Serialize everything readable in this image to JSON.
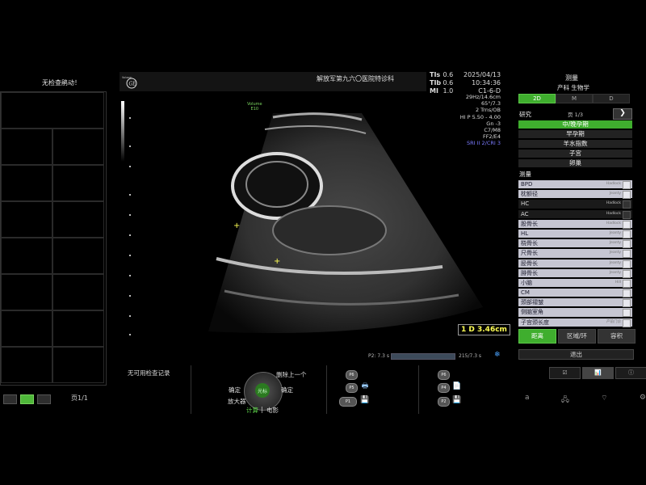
{
  "left_panel": {
    "no_exam_text": "无检查鹃动！",
    "page_label": "页1/1"
  },
  "header": {
    "hospital": "解放军第九六〇医院特诊科",
    "tis": "0.6",
    "tib": "0.6",
    "mi": "1.0",
    "date": "2025/04/13",
    "time": "10:34:36",
    "probe": "C1-6-D"
  },
  "tis_labels": {
    "tis": "TIs",
    "tib": "TIb",
    "mi": "MI"
  },
  "imaging_params": {
    "lines": [
      "29Hz/14.6cm",
      "65°/7.3",
      "2 Trns/OB",
      "HI P 5.50 - 4.00",
      "Gn -3",
      "C7/M8",
      "FF2/E4"
    ],
    "highlight_line": "SRI II 2/CRI 3"
  },
  "probe_marker": {
    "line1": "Volume",
    "line2": "E10"
  },
  "ge_logo": {
    "small_text": "Voluson"
  },
  "measurement_result": "1 D 3.46cm",
  "cine": {
    "left": "P2: 7.3 s",
    "right": "215/7.3 s"
  },
  "bottom": {
    "no_records": "无可用检查记录",
    "trackball": {
      "confirm_left": "确定",
      "confirm_right": "确定",
      "delete_prev": "删除上一个",
      "magnifier": "放大器",
      "center": "光标",
      "calc": "计算",
      "sep": "|",
      "film": "电影"
    },
    "p_buttons_left": [
      "P6",
      "P5",
      "P1"
    ],
    "p_buttons_right": [
      "P6",
      "P4",
      "P2"
    ]
  },
  "right_panel": {
    "title": "测量",
    "subtitle": "产科 生物学",
    "mode_tabs": [
      "2D",
      "M",
      "D"
    ],
    "study_label": "研究",
    "study_page": "页 1/3",
    "next_symbol": "❯",
    "study_items": [
      "中/晚孕期",
      "早孕期",
      "羊水指数",
      "子宫",
      "卵巢"
    ],
    "meas_label": "测量",
    "meas_items": [
      {
        "name": "BPD",
        "tag": "Hadlock",
        "dark": false
      },
      {
        "name": "枕额径",
        "tag": "Jeanty",
        "dark": false
      },
      {
        "name": "HC",
        "tag": "Hadlock",
        "dark": true
      },
      {
        "name": "AC",
        "tag": "Hadlock",
        "dark": true
      },
      {
        "name": "股骨长",
        "tag": "Hadlock",
        "dark": false
      },
      {
        "name": "HL",
        "tag": "Jeanty",
        "dark": false
      },
      {
        "name": "桡骨长",
        "tag": "Jeanty",
        "dark": false
      },
      {
        "name": "尺骨长",
        "tag": "Jeanty",
        "dark": false
      },
      {
        "name": "胫骨长",
        "tag": "Jeanty",
        "dark": false
      },
      {
        "name": "腓骨长",
        "tag": "Jeanty",
        "dark": false
      },
      {
        "name": "小脑",
        "tag": "Hill",
        "dark": false
      },
      {
        "name": "CM",
        "tag": "",
        "dark": false
      },
      {
        "name": "颈部褶皱",
        "tag": "",
        "dark": false
      },
      {
        "name": "侧脑室角",
        "tag": "",
        "dark": false
      },
      {
        "name": "子宫颈长度",
        "tag": "产前门诊",
        "dark": false
      }
    ],
    "tools": [
      "距离",
      "区域/环",
      "容积"
    ],
    "exit": "退出",
    "view_tabs": [
      "☑",
      "📊",
      "ⓘ"
    ]
  },
  "colors": {
    "accent_green": "#3fae2e",
    "measure_yellow": "#ffff55",
    "param_highlight": "#7b7bff"
  }
}
